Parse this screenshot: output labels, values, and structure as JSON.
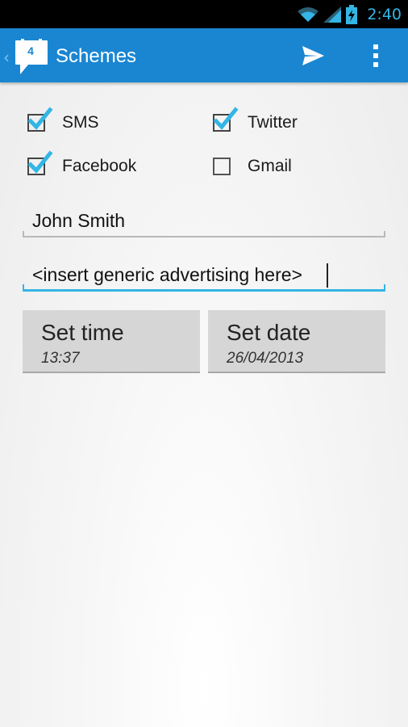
{
  "status_bar": {
    "time": "2:40",
    "icons": [
      "wifi-icon",
      "signal-icon",
      "battery-charging-icon"
    ],
    "time_color": "#33b5e5"
  },
  "action_bar": {
    "title": "Schemes",
    "logo_badge": "4",
    "background_color": "#1a86d2",
    "actions": [
      "send-icon",
      "overflow-menu-icon"
    ]
  },
  "channels": [
    {
      "label": "SMS",
      "checked": true
    },
    {
      "label": "Twitter",
      "checked": true
    },
    {
      "label": "Facebook",
      "checked": true
    },
    {
      "label": "Gmail",
      "checked": false
    }
  ],
  "form": {
    "recipient": "John Smith",
    "message": "<insert generic advertising here>",
    "accent_color": "#33b5e5"
  },
  "buttons": {
    "time": {
      "title": "Set time",
      "value": "13:37"
    },
    "date": {
      "title": "Set date",
      "value": "26/04/2013"
    }
  }
}
